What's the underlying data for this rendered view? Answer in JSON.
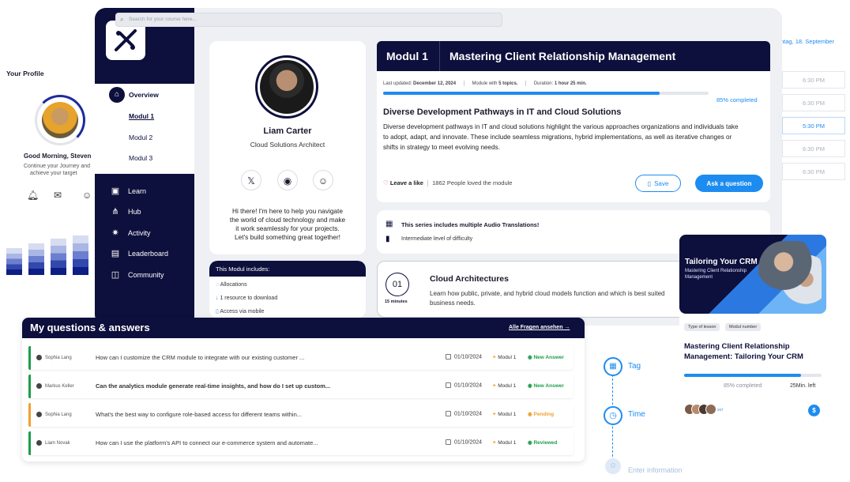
{
  "profile": {
    "heading": "Your Profile",
    "greeting": "Good Morning, Steven",
    "sub1": "Continue your Journey and",
    "sub2": "achieve your target"
  },
  "sidebar": {
    "overview": "Overview",
    "modules": [
      "Modul 1",
      "Modul 2",
      "Modul 3"
    ],
    "items": [
      "Learn",
      "Hub",
      "Activity",
      "Leaderboard",
      "Community"
    ]
  },
  "search": {
    "placeholder": "Search for your course here..."
  },
  "instructor": {
    "name": "Liam Carter",
    "role": "Cloud Solutions Architect",
    "bio1": "Hi there! I'm here to help you navigate",
    "bio2": "the world of cloud technology and make",
    "bio3": "it work seamlessly for your projects.",
    "bio4": "Let's build something great together!"
  },
  "includes": {
    "title": "This Modul includes:",
    "items": [
      "Allocations",
      "1 resource to download",
      "Access via mobile"
    ]
  },
  "module": {
    "label": "Modul 1",
    "title": "Mastering Client Relationship Management",
    "updated_label": "Last updated:",
    "updated_value": "December 12, 2024",
    "topics_label": "Module with",
    "topics_value": "5 topics.",
    "duration_label": "Duration:",
    "duration_value": "1 hour 25 min.",
    "progress": 0.85,
    "progress_text": "85% completed",
    "heading": "Diverse Development Pathways in IT and Cloud Solutions",
    "desc1": "Diverse development pathways in IT and cloud solutions highlight the various approaches organizations and individuals take",
    "desc2": "to adopt, adapt, and innovate. These include seamless migrations, hybrid implementations, as well as iterative changes or",
    "desc3": "shifts in strategy to meet evolving needs.",
    "like_label": "Leave a like",
    "likes_text": "1862 People loved the module",
    "save_label": "Save",
    "ask_label": "Ask a question"
  },
  "series": {
    "audio": "This series includes multiple Audio Translations!",
    "level": "Intermediate level of difficulty"
  },
  "lesson": {
    "number": "01",
    "minutes": "15 minutes",
    "title": "Cloud Architectures",
    "desc1": "Learn how public, private, and hybrid cloud models function and which is best suited",
    "desc2": "business needs."
  },
  "qa": {
    "title": "My questions & answers",
    "link": "Alle Fragen ansehen →",
    "rows": [
      {
        "user": "Sophia Lang",
        "question": "How can I customize the CRM module to integrate with our existing customer ...",
        "date": "01/10/2024",
        "module": "Modul 1",
        "status": "New Answer",
        "color": "#1e9e4a"
      },
      {
        "user": "Markus Keller",
        "question": "Can the analytics module generate real-time insights, and how do I set up custom...",
        "date": "01/10/2024",
        "module": "Modul 1",
        "status": "New Answer",
        "color": "#1e9e4a"
      },
      {
        "user": "Sophia Lang",
        "question": "What's the best way to configure role-based access for different teams within...",
        "date": "01/10/2024",
        "module": "Modul 1",
        "status": "Pending",
        "color": "#f0a132"
      },
      {
        "user": "Liam Novak",
        "question": "How can I use the platform's API to connect our e-commerce system and automate...",
        "date": "01/10/2024",
        "module": "Modul 1",
        "status": "Reviewed",
        "color": "#1e9e4a"
      }
    ]
  },
  "calendar": {
    "date": "ntag, 18. September",
    "slots": [
      "6:30 PM",
      "6:30 PM",
      "5:30 PM",
      "6:30 PM",
      "6:30 PM"
    ]
  },
  "timeline": {
    "tag": "Tag",
    "time": "Time",
    "enter": "Enter information"
  },
  "course_card": {
    "thumb_title": "Tailoring Your CRM",
    "thumb_sub1": "Mastering Client Relationship",
    "thumb_sub2": "Management",
    "chip1": "Type of lesson",
    "chip2": "Modul number",
    "title1": "Mastering Client Relationship",
    "title2": "Management: Tailoring Your CRM",
    "progress": 0.85,
    "progress_text": "85% completed",
    "time_left": "25Min. left",
    "avatar_count": "267"
  },
  "colors": {
    "navy": "#0d0f3c",
    "accent": "#1d8cf0",
    "green": "#1e9e4a",
    "orange": "#f0a132"
  }
}
